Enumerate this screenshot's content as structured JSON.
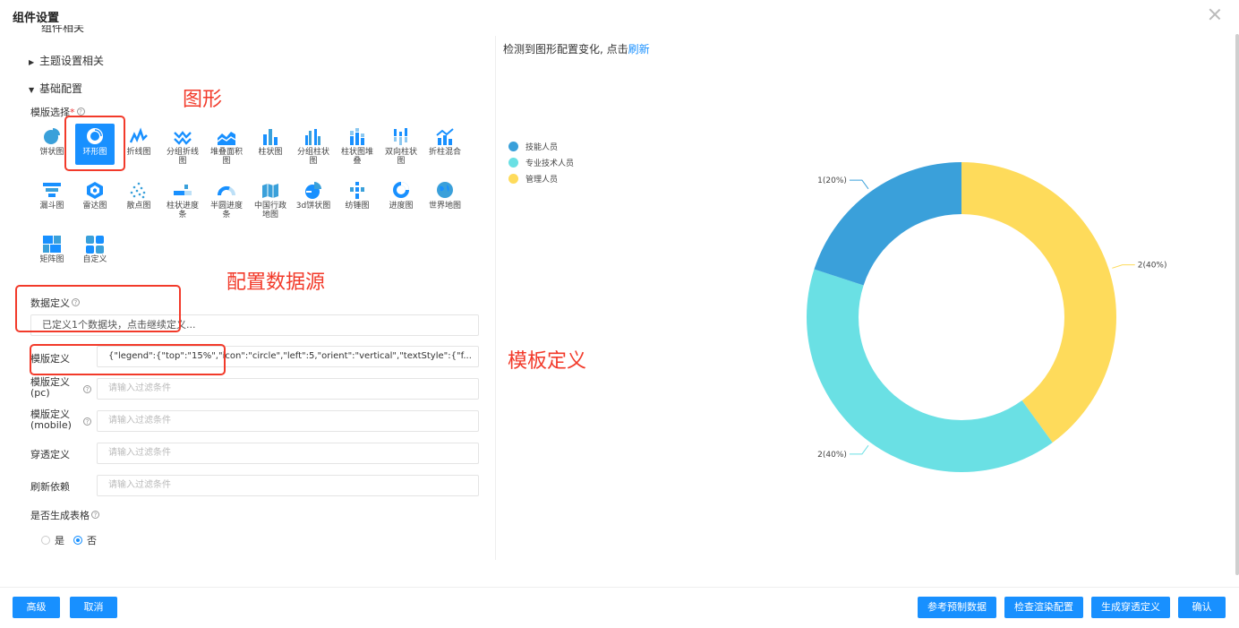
{
  "dialog": {
    "title": "组件设置"
  },
  "sections": {
    "cut_label": "组件相关",
    "theme": "主题设置相关",
    "basic": "基础配置"
  },
  "template_select": {
    "label": "模版选择",
    "required_mark": "*",
    "items": [
      {
        "label": "饼状图",
        "icon": "pie-chart-icon"
      },
      {
        "label": "环形图",
        "icon": "donut-chart-icon",
        "selected": true
      },
      {
        "label": "折线图",
        "icon": "line-chart-icon"
      },
      {
        "label": "分组折线图",
        "icon": "grouped-line-icon"
      },
      {
        "label": "堆叠面积图",
        "icon": "stacked-area-icon"
      },
      {
        "label": "柱状图",
        "icon": "bar-chart-icon"
      },
      {
        "label": "分组柱状图",
        "icon": "grouped-bar-icon"
      },
      {
        "label": "柱状图堆叠",
        "icon": "stacked-bar-icon"
      },
      {
        "label": "双向柱状图",
        "icon": "bidirectional-bar-icon"
      },
      {
        "label": "折柱混合",
        "icon": "line-bar-mix-icon"
      },
      {
        "label": "漏斗图",
        "icon": "funnel-icon"
      },
      {
        "label": "雷达图",
        "icon": "radar-icon"
      },
      {
        "label": "散点图",
        "icon": "scatter-icon"
      },
      {
        "label": "柱状进度条",
        "icon": "bar-progress-icon"
      },
      {
        "label": "半圆进度条",
        "icon": "semicircle-progress-icon"
      },
      {
        "label": "中国行政地图",
        "icon": "china-map-icon"
      },
      {
        "label": "3d饼状图",
        "icon": "pie-3d-icon"
      },
      {
        "label": "纺锤图",
        "icon": "spindle-icon"
      },
      {
        "label": "进度图",
        "icon": "progress-ring-icon"
      },
      {
        "label": "世界地图",
        "icon": "globe-icon"
      },
      {
        "label": "矩阵图",
        "icon": "matrix-icon"
      },
      {
        "label": "自定义",
        "icon": "custom-grid-icon"
      }
    ]
  },
  "data_def": {
    "label": "数据定义",
    "value": "已定义1个数据块，点击继续定义..."
  },
  "fields": {
    "template_def": {
      "label": "模版定义",
      "value": "{\"legend\":{\"top\":\"15%\",\"icon\":\"circle\",\"left\":5,\"orient\":\"vertical\",\"textStyle\":{\"f..."
    },
    "template_pc": {
      "label1": "模版定义",
      "label2": "(pc)",
      "placeholder": "请输入过滤条件"
    },
    "template_mobile": {
      "label1": "模版定义",
      "label2": "(mobile)",
      "placeholder": "请输入过滤条件"
    },
    "drill": {
      "label": "穿透定义",
      "placeholder": "请输入过滤条件"
    },
    "refresh_dep": {
      "label": "刷新依赖",
      "placeholder": "请输入过滤条件"
    }
  },
  "gen_table": {
    "label": "是否生成表格",
    "yes": "是",
    "no": "否",
    "selected": "no"
  },
  "annotations": {
    "shape": "图形",
    "datasource": "配置数据源",
    "template": "模板定义"
  },
  "preview": {
    "hint": "检测到图形配置变化, 点击",
    "refresh": "刷新"
  },
  "chart_data": {
    "type": "pie",
    "variant": "donut",
    "categories": [
      "技能人员",
      "专业技术人员",
      "管理人员"
    ],
    "values": [
      1,
      2,
      2
    ],
    "labels": [
      "1(20%)",
      "2(40%)",
      "2(40%)"
    ],
    "colors": [
      "#3aa0da",
      "#6ae0e4",
      "#fedb5b"
    ],
    "legend": "left, vertical",
    "label_order_clockwise_from_top": [
      "管理人员",
      "专业技术人员",
      "技能人员"
    ]
  },
  "footer": {
    "advanced": "高级",
    "cancel": "取消",
    "ref_data": "参考预制数据",
    "check_render": "检查渲染配置",
    "gen_drill": "生成穿透定义",
    "confirm": "确认"
  }
}
